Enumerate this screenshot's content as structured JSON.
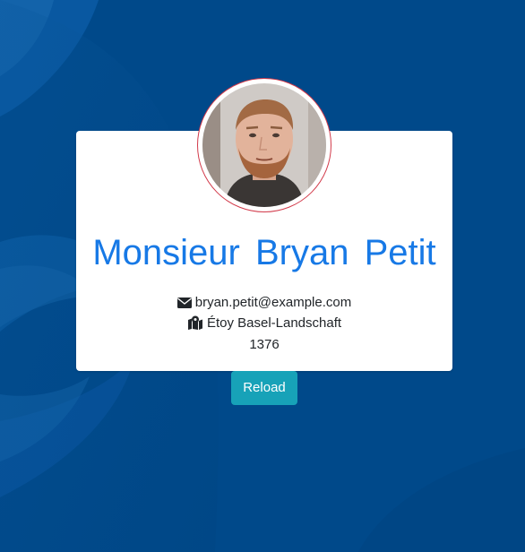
{
  "colors": {
    "background": "#00498a",
    "card": "#ffffff",
    "name": "#1779e6",
    "avatar_border": "#d23a4a",
    "button": "#17a2b8"
  },
  "profile": {
    "name": "Monsieur Bryan Petit",
    "email": "bryan.petit@example.com",
    "location": "Étoy Basel-Landschaft",
    "postcode": "1376",
    "email_icon": "envelope-icon",
    "location_icon": "map-marked-icon"
  },
  "actions": {
    "reload_label": "Reload"
  }
}
